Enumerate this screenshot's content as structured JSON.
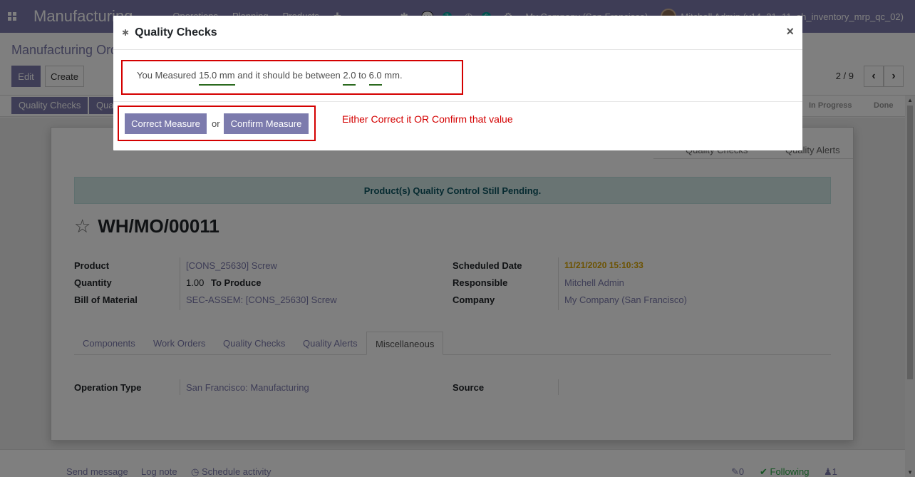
{
  "navbar": {
    "brand": "Manufacturing",
    "menu": [
      "Operations",
      "Planning",
      "Products"
    ],
    "company": "My Company (San Francisco)",
    "user": "Mitchell Admin (v14_21_11_sh_inventory_mrp_qc_02)",
    "chat_badge": "7",
    "activity_badge": "6"
  },
  "control": {
    "breadcrumb": "Manufacturing Orders",
    "edit_label": "Edit",
    "create_label": "Create",
    "pager": "2 / 9"
  },
  "statusbar": {
    "quality_checks_label": "Quality Checks",
    "second_label": "Qua",
    "stage_in_progress": "In Progress",
    "stage_done": "Done"
  },
  "sheet": {
    "smart_quality_checks": "Quality Checks",
    "smart_quality_alerts": "Quality Alerts",
    "alert_text": "Product(s) Quality Control Still Pending.",
    "mo_name": "WH/MO/00011",
    "fields": {
      "product_label": "Product",
      "product_value": "[CONS_25630] Screw",
      "quantity_label": "Quantity",
      "quantity_value": "1.00",
      "quantity_unit": "To Produce",
      "bom_label": "Bill of Material",
      "bom_value": "SEC-ASSEM: [CONS_25630] Screw",
      "scheduled_label": "Scheduled Date",
      "scheduled_value": "11/21/2020 15:10:33",
      "responsible_label": "Responsible",
      "responsible_value": "Mitchell Admin",
      "company_label": "Company",
      "company_value": "My Company (San Francisco)"
    },
    "tabs": [
      "Components",
      "Work Orders",
      "Quality Checks",
      "Quality Alerts",
      "Miscellaneous"
    ],
    "misc": {
      "operation_type_label": "Operation Type",
      "operation_type_value": "San Francisco: Manufacturing",
      "source_label": "Source"
    }
  },
  "chatter": {
    "send_message": "Send message",
    "log_note": "Log note",
    "schedule_activity": "Schedule activity",
    "attachments": "0",
    "following": "Following",
    "followers": "1"
  },
  "dialog": {
    "title": "Quality Checks",
    "text_prefix": "You Measured",
    "measured": "15.0",
    "unit1": "mm",
    "text_mid": "and it should be between",
    "min": "2.0",
    "to": "to",
    "max": "6.0",
    "unit2": "mm.",
    "correct_label": "Correct Measure",
    "or_label": "or",
    "confirm_label": "Confirm Measure",
    "annotation": "Either Correct it OR Confirm that value"
  },
  "colors": {
    "brand": "#7c7bad",
    "annotation_red": "#d40000",
    "underline_green": "#2b6a1f",
    "scheduled_date": "#d9a400"
  }
}
